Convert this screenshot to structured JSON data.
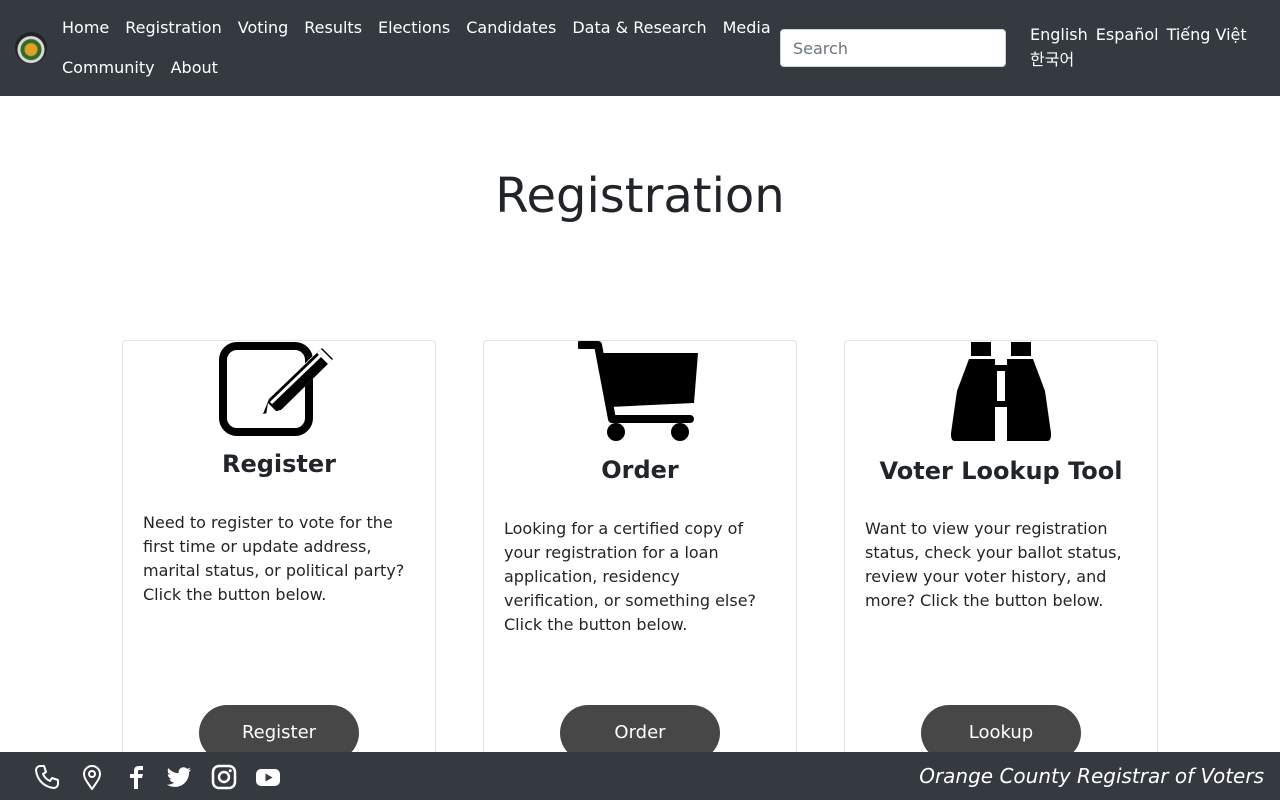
{
  "nav": {
    "items": [
      {
        "label": "Home"
      },
      {
        "label": "Registration"
      },
      {
        "label": "Voting"
      },
      {
        "label": "Results"
      },
      {
        "label": "Elections"
      },
      {
        "label": "Candidates"
      },
      {
        "label": "Data & Research"
      },
      {
        "label": "Media"
      },
      {
        "label": "Community"
      },
      {
        "label": "About"
      }
    ],
    "search_placeholder": "Search",
    "languages": [
      {
        "label": "English"
      },
      {
        "label": "Español"
      },
      {
        "label": "Tiếng Việt"
      },
      {
        "label": "한국어"
      }
    ]
  },
  "main": {
    "title": "Registration",
    "cards": [
      {
        "icon": "edit-icon",
        "title": "Register",
        "text": "Need to register to vote for the first time or update address, marital status, or political party? Click the button below.",
        "button": "Register"
      },
      {
        "icon": "shopping-cart-icon",
        "title": "Order",
        "text": "Looking for a certified copy of your registration for a loan application, residency verification, or something else? Click the button below.",
        "button": "Order"
      },
      {
        "icon": "binoculars-icon",
        "title": "Voter Lookup Tool",
        "text": "Want to view your registration status, check your ballot status, review your voter history, and more? Click the button below.",
        "button": "Lookup"
      }
    ]
  },
  "footer": {
    "icons": [
      "phone-icon",
      "map-marker-icon",
      "facebook-icon",
      "twitter-icon",
      "instagram-icon",
      "youtube-icon"
    ],
    "org_name": "Orange County Registrar of Voters"
  },
  "colors": {
    "navbar_bg": "#343a40",
    "button_bg": "#474747",
    "text": "#212529"
  }
}
